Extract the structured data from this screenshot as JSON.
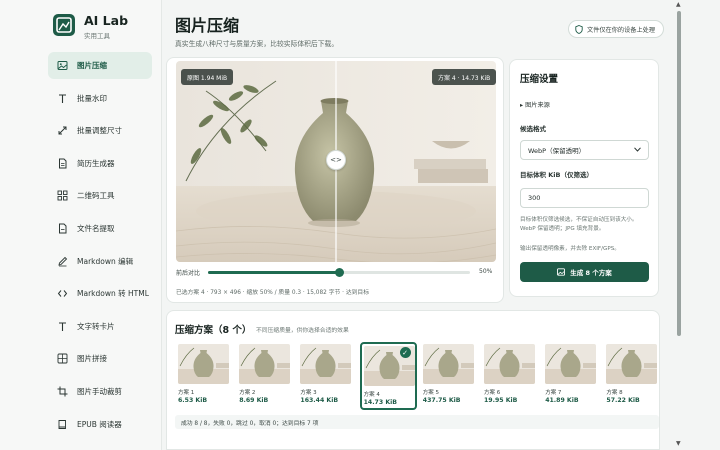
{
  "brand": {
    "title": "AI Lab",
    "subtitle": "实用工具",
    "logo_color": "#1e5b47"
  },
  "sidebar": {
    "items": [
      {
        "label": "图片压缩",
        "icon": "image-icon",
        "active": true
      },
      {
        "label": "批量水印",
        "icon": "text-t-icon"
      },
      {
        "label": "批量调整尺寸",
        "icon": "resize-arrows-icon"
      },
      {
        "label": "简历生成器",
        "icon": "document-icon"
      },
      {
        "label": "二维码工具",
        "icon": "qr-grid-icon"
      },
      {
        "label": "文件名提取",
        "icon": "file-icon"
      },
      {
        "label": "Markdown 编辑",
        "icon": "pen-icon"
      },
      {
        "label": "Markdown 转 HTML",
        "icon": "code-brackets-icon"
      },
      {
        "label": "文字转卡片",
        "icon": "text-t-icon"
      },
      {
        "label": "图片拼接",
        "icon": "image-grid-icon"
      },
      {
        "label": "图片手动裁剪",
        "icon": "crop-icon"
      },
      {
        "label": "EPUB 阅读器",
        "icon": "book-icon"
      }
    ]
  },
  "header": {
    "title": "图片压缩",
    "subtitle": "真实生成八种尺寸与质量方案，比较实际体积后下载。",
    "privacy": "文件仅在你的设备上处理"
  },
  "preview": {
    "original_label": "原图 1.94 MiB",
    "plan_label": "方案 4 · 14.73 KiB",
    "handle_glyph": "<>",
    "slider_label": "前后对比",
    "slider_value": "50%",
    "slider_fraction": 0.5,
    "info": "已选方案 4 · 793 × 496 · 缩放 50% / 质量 0.3 · 15,082 字节 · 达到目标"
  },
  "settings": {
    "title": "压缩设置",
    "source_toggle": "▸ 图片来源",
    "format_label": "候选格式",
    "format_value": "WebP（保留透明）",
    "target_label": "目标体积 KiB（仅筛选）",
    "target_value": "300",
    "hint1": "目标体积仅筛选候选，不保证自动压到该大小。WebP 保留透明；JPG 填充背景。",
    "hint2": "输出保留透明像素，并去除 EXIF/GPS。",
    "generate_button": "生成 8 个方案",
    "accent": "#1e5b47"
  },
  "plans": {
    "title": "压缩方案（8 个）",
    "hint": "不同压缩质量，供你选择合适的效果",
    "items": [
      {
        "name": "方案 1",
        "size": "6.53 KiB"
      },
      {
        "name": "方案 2",
        "size": "8.69 KiB"
      },
      {
        "name": "方案 3",
        "size": "163.44 KiB"
      },
      {
        "name": "方案 4",
        "size": "14.73 KiB",
        "selected": true
      },
      {
        "name": "方案 5",
        "size": "437.75 KiB"
      },
      {
        "name": "方案 6",
        "size": "19.95 KiB"
      },
      {
        "name": "方案 7",
        "size": "41.89 KiB"
      },
      {
        "name": "方案 8",
        "size": "57.22 KiB"
      }
    ],
    "status": "成功 8 / 8，失败 0，跳过 0，取消 0；达到目标 7 项"
  }
}
